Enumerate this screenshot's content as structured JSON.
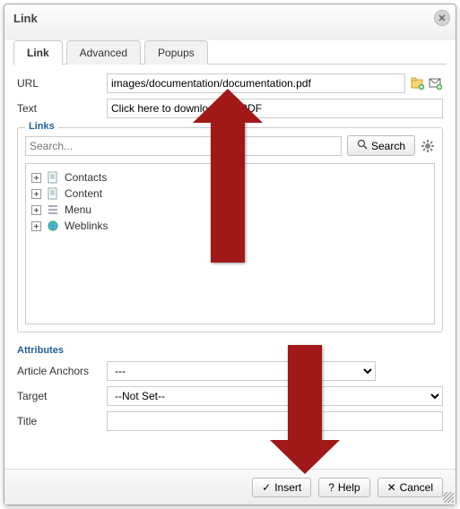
{
  "title": "Link",
  "tabs": {
    "link": "Link",
    "advanced": "Advanced",
    "popups": "Popups"
  },
  "fields": {
    "url_label": "URL",
    "url_value": "images/documentation/documentation.pdf",
    "text_label": "Text",
    "text_value": "Click here to download my PDF"
  },
  "links": {
    "legend": "Links",
    "search_placeholder": "Search...",
    "search_button": "Search",
    "items": [
      "Contacts",
      "Content",
      "Menu",
      "Weblinks"
    ]
  },
  "attributes": {
    "legend": "Attributes",
    "anchors_label": "Article Anchors",
    "anchors_value": "---",
    "target_label": "Target",
    "target_value": "--Not Set--",
    "title_label": "Title",
    "title_value": ""
  },
  "buttons": {
    "insert": "Insert",
    "help": "Help",
    "cancel": "Cancel"
  }
}
